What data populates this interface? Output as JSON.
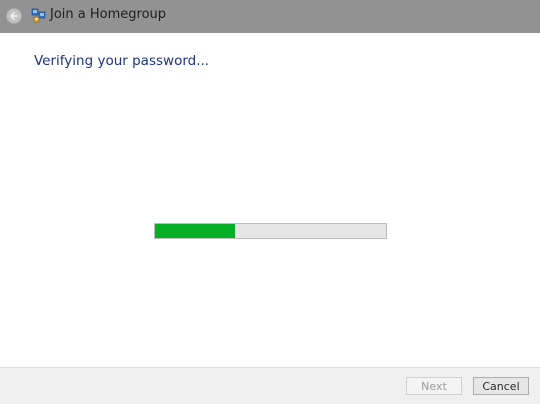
{
  "window": {
    "title": "Join a Homegroup",
    "icons": {
      "back": "back-arrow-icon",
      "app": "homegroup-icon"
    }
  },
  "content": {
    "heading": "Verifying your password...",
    "progress_fraction": 0.345
  },
  "footer": {
    "next_label": "Next",
    "next_enabled": false,
    "cancel_label": "Cancel",
    "cancel_enabled": true
  },
  "colors": {
    "title_bar": "#929292",
    "heading_text": "#1e3287",
    "progress_fill": "#06b025",
    "progress_track": "#e6e6e6",
    "footer_bg": "#f0f0f0"
  }
}
